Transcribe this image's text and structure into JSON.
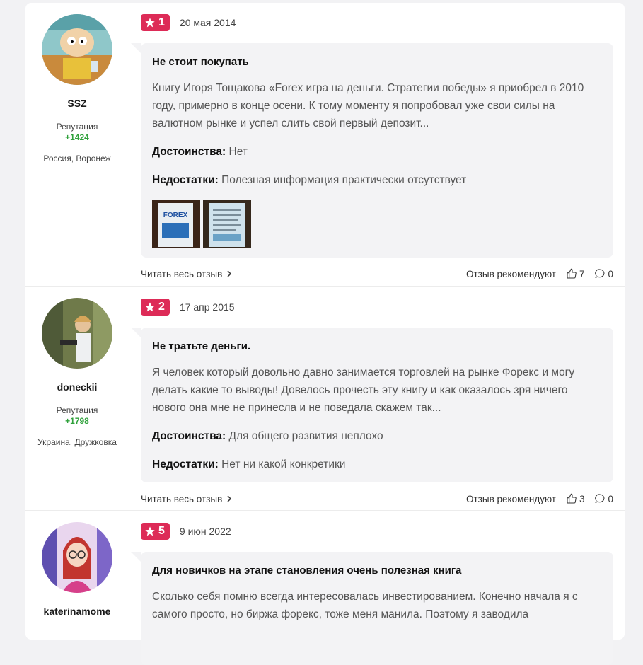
{
  "reviews": [
    {
      "username": "SSZ",
      "reputation_label": "Репутация",
      "reputation": "+1424",
      "location": "Россия, Воронеж",
      "rating": "1",
      "date": "20 мая 2014",
      "title": "Не стоит покупать",
      "text": "Книгу Игоря Тощакова «Forex игра на деньги. Стратегии победы» я приобрел в 2010 году, примерно в конце осени. К тому моменту я попробовал уже свои силы на валютном рынке и успел слить свой первый депозит...",
      "pros_label": "Достоинства:",
      "pros": "Нет",
      "cons_label": "Недостатки:",
      "cons": "Полезная информация практически отсутствует",
      "read_more": "Читать весь отзыв",
      "recommend": "Отзыв рекомендуют",
      "likes": "7",
      "comments": "0"
    },
    {
      "username": "doneckii",
      "reputation_label": "Репутация",
      "reputation": "+1798",
      "location": "Украина, Дружковка",
      "rating": "2",
      "date": "17 апр 2015",
      "title": "Не тратьте деньги.",
      "text": "Я человек который довольно давно занимается торговлей на рынке Форекс и могу делать какие то выводы! Довелось прочесть эту книгу и как оказалось зря ничего нового она мне не принесла и не поведала скажем так...",
      "pros_label": "Достоинства:",
      "pros": "Для общего развития неплохо",
      "cons_label": "Недостатки:",
      "cons": "Нет ни какой конкретики",
      "read_more": "Читать весь отзыв",
      "recommend": "Отзыв рекомендуют",
      "likes": "3",
      "comments": "0"
    },
    {
      "username": "katerinamome",
      "rating": "5",
      "date": "9 июн 2022",
      "title": "Для новичков на этапе становления очень полезная книга",
      "text": "Сколько себя помню всегда интересовалась инвестированием. Конечно начала я с самого просто, но биржа форекс, тоже меня манила. Поэтому я заводила"
    }
  ],
  "colors": {
    "badge": "#dd2b57",
    "reputation": "#2fa13b",
    "bubble": "#f3f3f5"
  }
}
